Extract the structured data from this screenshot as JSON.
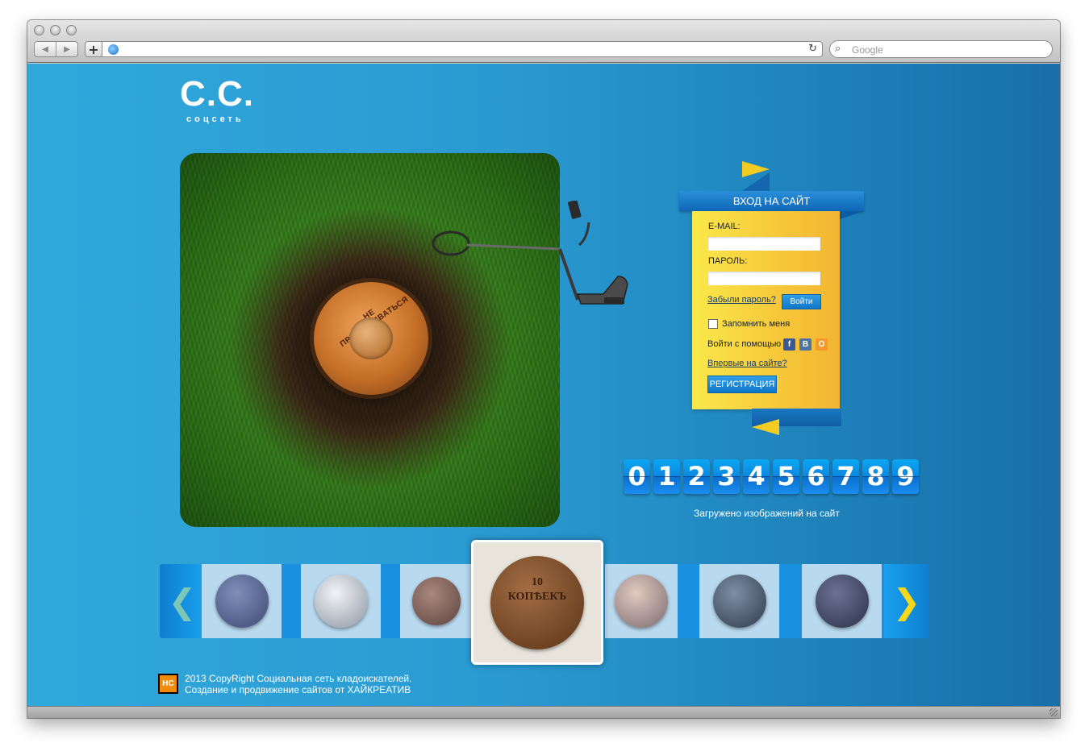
{
  "browser": {
    "search_placeholder": "Google",
    "back_icon": "back-arrow-icon",
    "forward_icon": "forward-arrow-icon",
    "add_label": "+",
    "reload_glyph": "↻",
    "search_glyph": "⌕"
  },
  "logo": {
    "title": "C.C.",
    "subtitle": "соцсеть"
  },
  "hero": {
    "emblem_text": "НЕ ПРИТРАГИВАТЬСЯ"
  },
  "login": {
    "header": "ВХОД НА САЙТ",
    "email_label": "E-MAIL:",
    "email_value": "",
    "password_label": "ПАРОЛЬ:",
    "password_value": "",
    "forgot_link": "Забыли пароль?",
    "submit_button": "Войти",
    "remember_label": "Запомнить меня",
    "remember_checked": false,
    "social_label": "Войти с помощью",
    "social": [
      {
        "name": "facebook",
        "glyph": "f",
        "color": "#3b5998"
      },
      {
        "name": "vkontakte",
        "glyph": "B",
        "color": "#4c75a3"
      },
      {
        "name": "odnoklassniki",
        "glyph": "O",
        "color": "#f59a2b"
      }
    ],
    "first_time_link": "Впервые на сайте?",
    "register_button": "РЕГИСТРАЦИЯ"
  },
  "counter": {
    "digits": [
      "0",
      "1",
      "2",
      "3",
      "4",
      "5",
      "6",
      "7",
      "8",
      "9"
    ],
    "caption": "Загружено изображений на сайт"
  },
  "carousel": {
    "prev_glyph": "❮",
    "next_glyph": "❯",
    "active_coin_text": [
      "10",
      "КОПѢЕКЪ"
    ],
    "items": [
      {
        "name": "coin-1",
        "color": "#5d6f9a"
      },
      {
        "name": "coin-2",
        "color": "#c8cfd8"
      },
      {
        "name": "coin-3",
        "color": "#8a6a60"
      },
      {
        "name": "coin-4-active",
        "color": "#8b5a33"
      },
      {
        "name": "coin-5",
        "color": "#b69b8f"
      },
      {
        "name": "coin-6",
        "color": "#556579"
      },
      {
        "name": "coin-7",
        "color": "#4d5570"
      }
    ]
  },
  "footer": {
    "logo_text": "HC",
    "line1": "2013 CopyRight Социальная сеть кладоискателей.",
    "line2": "Создание и продвижение сайтов от ХАЙКРЕАТИВ"
  }
}
